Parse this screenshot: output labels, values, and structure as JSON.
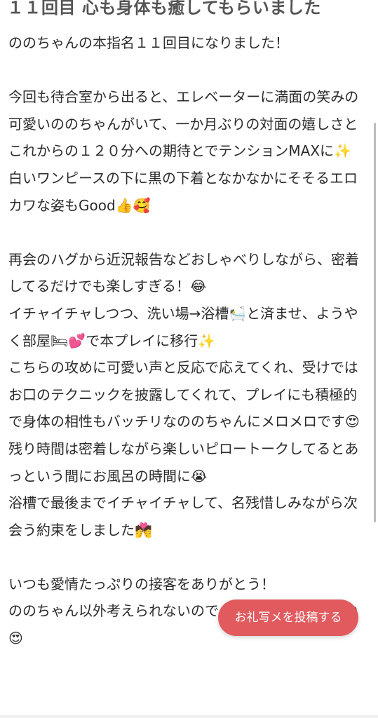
{
  "post": {
    "title": "１１回目 心も身体も癒してもらいました",
    "paragraphs": [
      "ののちゃんの本指名１１回目になりました！",
      "",
      "今回も待合室から出ると、エレベーターに満面の笑みの可愛いののちゃんがいて、一か月ぶりの対面の嬉しさとこれからの１２０分への期待とでテンションMAXに✨",
      "白いワンピースの下に黒の下着となかなかにそそるエロカワな姿もGood👍🥰",
      "",
      "再会のハグから近況報告などおしゃべりしながら、密着してるだけでも楽しすぎる！😂",
      "イチャイチャしつつ、洗い場→浴槽🛀と済ませ、ようやく部屋🛏💕で本プレイに移行✨",
      "こちらの攻めに可愛い声と反応で応えてくれ、受けではお口のテクニックを披露してくれて、プレイにも積極的で身体の相性もバッチリなののちゃんにメロメロです😍",
      "残り時間は密着しながら楽しいピロートークしてるとあっという間にお風呂の時間に😭",
      "浴槽で最後までイチャイチャして、名残惜しみながら次会う約束をしました💏",
      "",
      "いつも愛情たっぷりの接客をありがとう！",
      "ののちゃん以外考えられないので、今後ともよろしくね😍"
    ]
  },
  "actions": {
    "thank_you_post_button": "お礼写メを投稿する"
  },
  "colors": {
    "accent": "#e05a5e",
    "title_text": "#555555",
    "body_text": "#2b2b2b"
  }
}
